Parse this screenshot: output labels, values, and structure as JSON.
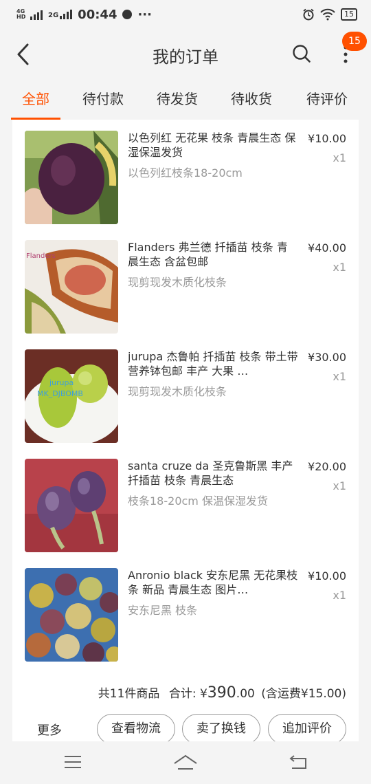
{
  "status_bar": {
    "network1": "4G HD",
    "network2": "2G",
    "time": "00:44",
    "dots": "···",
    "battery": "15"
  },
  "header": {
    "title": "我的订单",
    "badge": "15"
  },
  "tabs": [
    "全部",
    "待付款",
    "待发货",
    "待收货",
    "待评价"
  ],
  "items": [
    {
      "name": "以色列红 无花果 枝条 青晨生态 保湿保温发货",
      "sku": "以色列红枝条18-20cm",
      "price": "¥10.00",
      "qty": "x1",
      "watermark": ""
    },
    {
      "name": "Flanders 弗兰德 扦插苗 枝条 青晨生态 含盆包邮",
      "sku": "现剪现发木质化枝条",
      "price": "¥40.00",
      "qty": "x1",
      "watermark": "Flanders"
    },
    {
      "name": "jurupa 杰鲁帕 扦插苗 枝条 带土带营养钵包邮 丰产 大果 …",
      "sku": "现剪现发木质化枝条",
      "price": "¥30.00",
      "qty": "x1",
      "watermark": "jurupa MK_DJBOMB"
    },
    {
      "name": "santa cruze da 圣克鲁斯黑 丰产 扦插苗 枝条 青晨生态",
      "sku": "枝条18-20cm 保温保湿发货",
      "price": "¥20.00",
      "qty": "x1",
      "watermark": ""
    },
    {
      "name": "Anronio black 安东尼黑 无花果枝条 新品 青晨生态 图片…",
      "sku": "安东尼黑 枝条",
      "price": "¥10.00",
      "qty": "x1",
      "watermark": ""
    }
  ],
  "summary": {
    "count": "共11件商品",
    "total_label": "合计: ¥",
    "total_int": "390",
    "total_dec": ".00",
    "shipping": "(含运费¥15.00)"
  },
  "actions": {
    "more": "更多",
    "logistics": "查看物流",
    "resell": "卖了换钱",
    "review": "追加评价"
  },
  "colors": {
    "accent": "#ff5000"
  }
}
